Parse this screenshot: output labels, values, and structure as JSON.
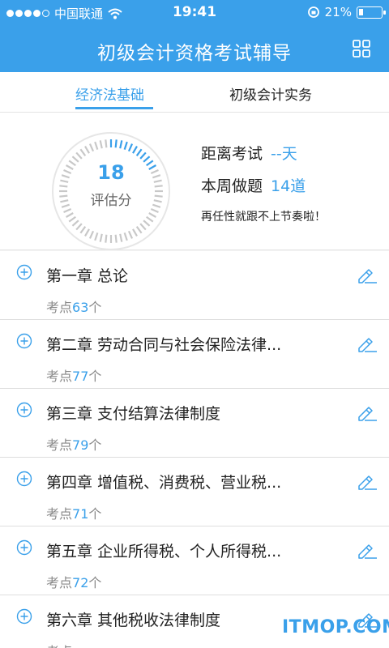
{
  "status_bar": {
    "carrier": "中国联通",
    "time": "19:41",
    "battery": "21%",
    "battery_level": 0.21
  },
  "nav": {
    "title": "初级会计资格考试辅导",
    "menu_icon": "grid-icon"
  },
  "tabs": [
    {
      "label": "经济法基础",
      "active": true
    },
    {
      "label": "初级会计实务",
      "active": false
    }
  ],
  "summary": {
    "score": "18",
    "score_label": "评估分",
    "countdown_label": "距离考试",
    "countdown_value": "--天",
    "weekly_label": "本周做题",
    "weekly_value": "14道",
    "slogan": "再任性就跟不上节奏啦！",
    "gauge_fraction": 0.18
  },
  "chapters": [
    {
      "title": "第一章 总论",
      "points_prefix": "考点",
      "points": "63",
      "points_suffix": "个"
    },
    {
      "title": "第二章 劳动合同与社会保险法律...",
      "points_prefix": "考点",
      "points": "77",
      "points_suffix": "个"
    },
    {
      "title": "第三章 支付结算法律制度",
      "points_prefix": "考点",
      "points": "79",
      "points_suffix": "个"
    },
    {
      "title": "第四章 增值税、消费税、营业税...",
      "points_prefix": "考点",
      "points": "71",
      "points_suffix": "个"
    },
    {
      "title": "第五章 企业所得税、个人所得税...",
      "points_prefix": "考点",
      "points": "72",
      "points_suffix": "个"
    },
    {
      "title": "第六章 其他税收法律制度",
      "points_prefix": "考点",
      "points": "",
      "points_suffix": ""
    }
  ],
  "watermark": "ITMOP.COM",
  "colors": {
    "accent": "#3aa0ea",
    "background": "#f4f4f4"
  }
}
